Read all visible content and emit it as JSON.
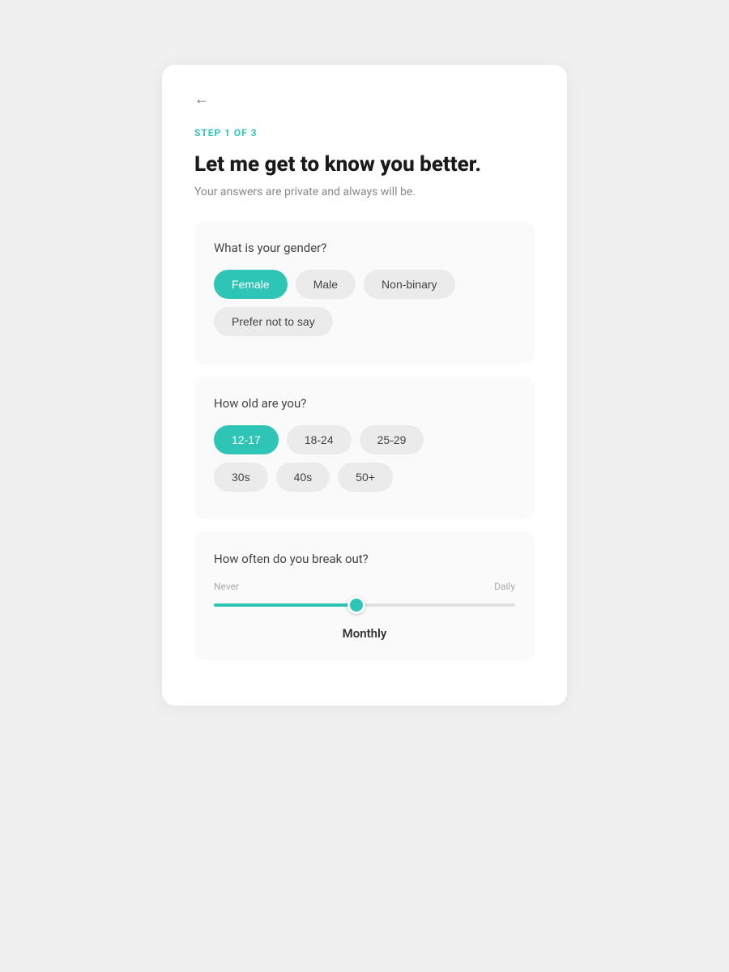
{
  "back_button": {
    "icon": "←",
    "label": "Back"
  },
  "step": {
    "label": "STEP 1 OF 3"
  },
  "header": {
    "title": "Let me get to know you better.",
    "subtitle": "Your answers are private and always will be."
  },
  "gender_question": {
    "label": "What is your gender?",
    "options": [
      {
        "id": "female",
        "label": "Female",
        "selected": true
      },
      {
        "id": "male",
        "label": "Male",
        "selected": false
      },
      {
        "id": "non-binary",
        "label": "Non-binary",
        "selected": false
      },
      {
        "id": "prefer-not",
        "label": "Prefer not to say",
        "selected": false
      }
    ]
  },
  "age_question": {
    "label": "How old are you?",
    "options": [
      {
        "id": "12-17",
        "label": "12-17",
        "selected": true
      },
      {
        "id": "18-24",
        "label": "18-24",
        "selected": false
      },
      {
        "id": "25-29",
        "label": "25-29",
        "selected": false
      },
      {
        "id": "30s",
        "label": "30s",
        "selected": false
      },
      {
        "id": "40s",
        "label": "40s",
        "selected": false
      },
      {
        "id": "50+",
        "label": "50+",
        "selected": false
      }
    ]
  },
  "breakout_question": {
    "label": "How often do you break out?",
    "slider": {
      "min_label": "Never",
      "max_label": "Daily",
      "value": 47,
      "current_value_label": "Monthly"
    }
  }
}
